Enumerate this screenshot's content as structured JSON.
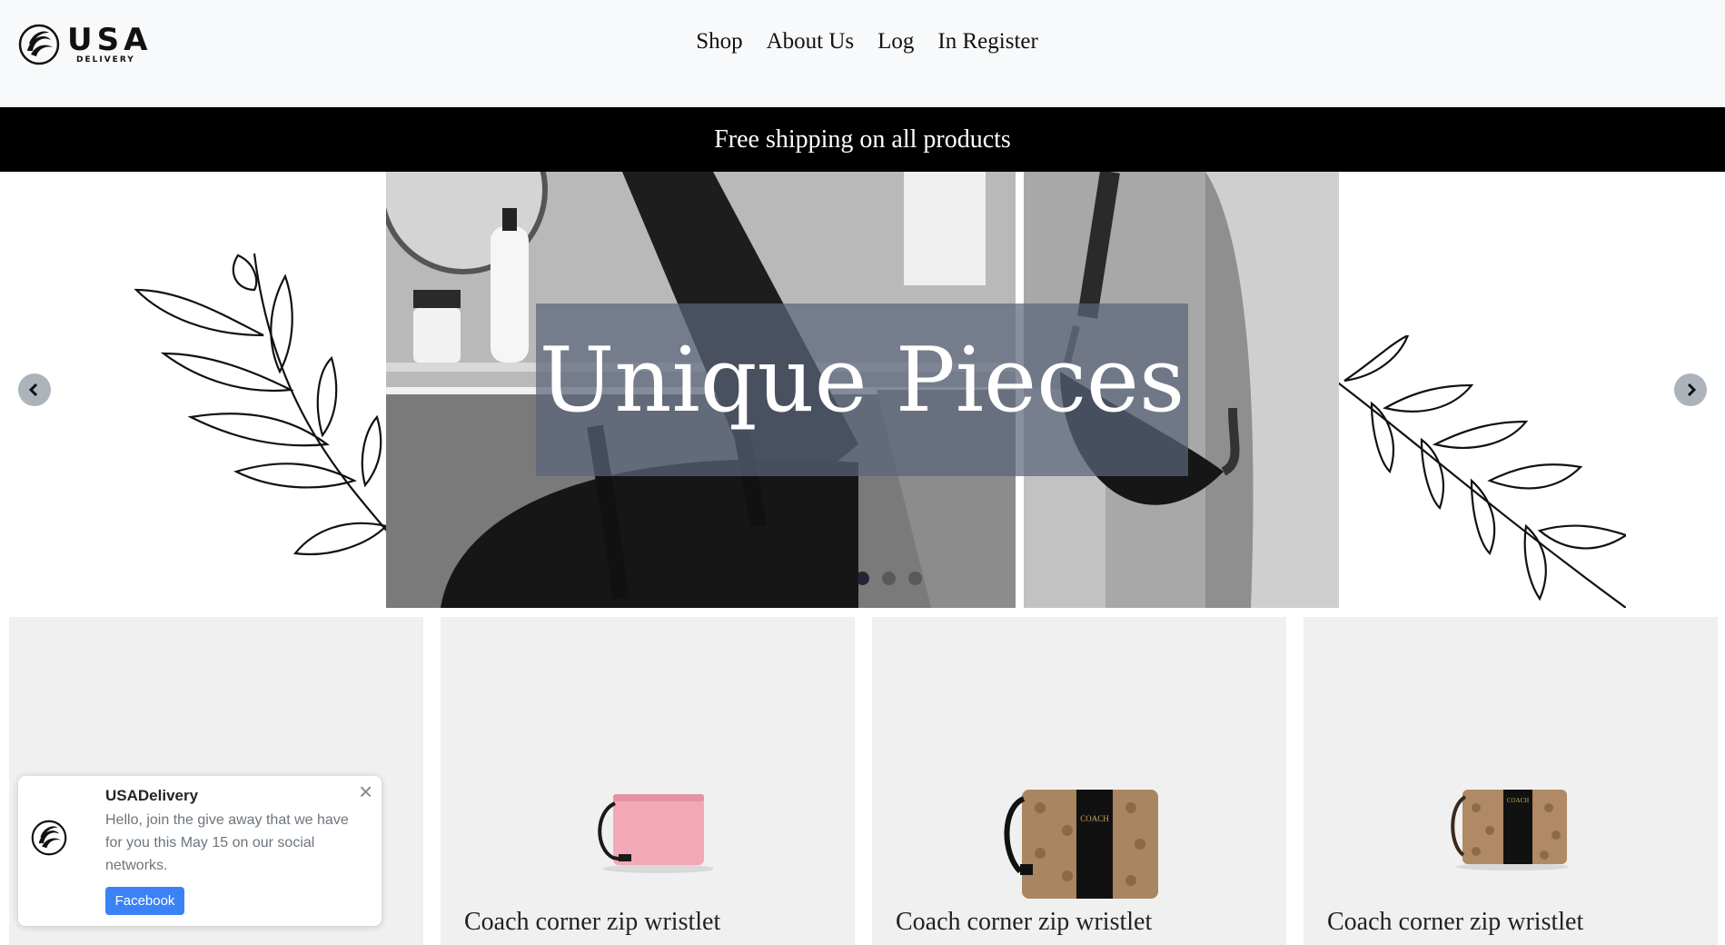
{
  "header": {
    "logo": {
      "brand": "USA",
      "sub": "DELIVERY"
    },
    "nav": [
      {
        "label": "Shop"
      },
      {
        "label": "About Us"
      },
      {
        "label": "Log"
      },
      {
        "label": "In Register"
      }
    ]
  },
  "banner": {
    "text": "Free shipping on all products"
  },
  "hero": {
    "title": "Unique Pieces",
    "slides_total": 3,
    "active_slide": 1
  },
  "products": [
    {
      "title": ""
    },
    {
      "title": "Coach corner zip wristlet"
    },
    {
      "title": "Coach corner zip wristlet"
    },
    {
      "title": "Coach corner zip wristlet"
    }
  ],
  "toast": {
    "title": "USADelivery",
    "body": "Hello, join the give away that we have for you this May 15 on our social networks.",
    "button": "Facebook"
  },
  "colors": {
    "header_bg": "#f8f9fa",
    "banner_bg": "#000000",
    "card_bg": "#f0f0f0",
    "toast_button": "#3b82f6"
  }
}
